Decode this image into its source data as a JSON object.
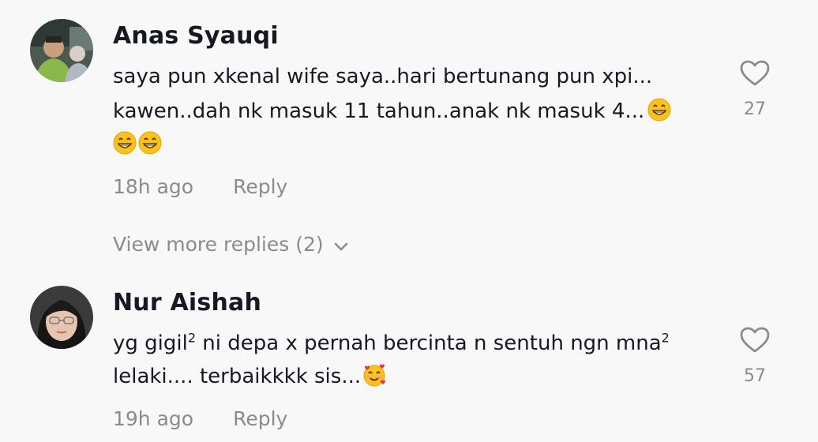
{
  "comments": [
    {
      "username": "Anas Syauqi",
      "lines": [
        "saya pun xkenal wife saya..hari bertunang pun xpi...",
        "kawen..dah nk masuk 11 tahun..anak nk masuk 4..."
      ],
      "emoji": "grinning-face-with-smiling-eyes",
      "time": "18h ago",
      "reply_label": "Reply",
      "like_count": "27",
      "view_more": "View more replies (2)"
    },
    {
      "username": "Nur Aishah",
      "line1_a": "yg gigil",
      "line1_sup1": "2",
      "line1_b": " ni depa x pernah bercinta n sentuh ngn mna",
      "line1_sup2": "2",
      "line2": "lelaki.... terbaikkkk sis...",
      "emoji": "smiling-face-with-hearts",
      "time": "19h ago",
      "reply_label": "Reply",
      "like_count": "57"
    }
  ]
}
